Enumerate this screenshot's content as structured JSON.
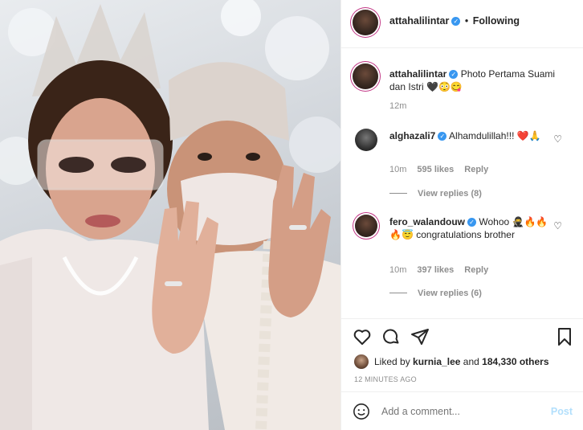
{
  "header": {
    "username": "attahalilintar",
    "separator": "•",
    "follow_status": "Following"
  },
  "caption": {
    "username": "attahalilintar",
    "text": "Photo Pertama Suami dan Istri 🖤😳😋",
    "time": "12m"
  },
  "comments": [
    {
      "username": "alghazali7",
      "text": "Alhamdulillah!!! ❤️🙏",
      "time": "10m",
      "likes": "595 likes",
      "reply": "Reply",
      "view_replies": "View replies (8)"
    },
    {
      "username": "fero_walandouw",
      "text": "Wohoo 🥷🔥🔥🔥😇 congratulations brother",
      "time": "10m",
      "likes": "397 likes",
      "reply": "Reply",
      "view_replies": "View replies (6)"
    }
  ],
  "likes": {
    "prefix": "Liked by",
    "user": "kurnia_lee",
    "and": "and",
    "count": "184,330 others"
  },
  "timestamp": "12 MINUTES AGO",
  "add_comment": {
    "placeholder": "Add a comment...",
    "post_label": "Post"
  },
  "colors": {
    "accent": "#3897f0",
    "heart_red": "#ed4956",
    "ring": "#c13584"
  }
}
